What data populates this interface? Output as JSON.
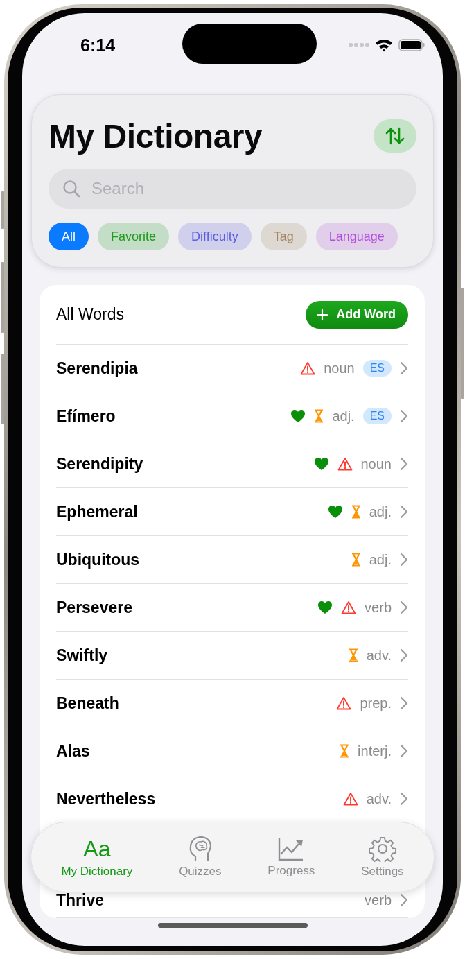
{
  "status_bar": {
    "time": "6:14"
  },
  "header": {
    "title": "My Dictionary",
    "search": {
      "placeholder": "Search"
    },
    "filters": [
      {
        "label": "All",
        "selected": true,
        "color": "#0a7aff"
      },
      {
        "label": "Favorite",
        "selected": false,
        "color": "#1e9a1e"
      },
      {
        "label": "Difficulty",
        "selected": false,
        "color": "#5b5ce0"
      },
      {
        "label": "Tag",
        "selected": false,
        "color": "#a2845e"
      },
      {
        "label": "Language",
        "selected": false,
        "color": "#b04fd8"
      }
    ]
  },
  "list": {
    "title": "All Words",
    "add_button": "Add Word",
    "rows": [
      {
        "word": "Serendipia",
        "favorite": false,
        "warning": true,
        "pending": false,
        "pos": "noun",
        "language": "ES"
      },
      {
        "word": "Efímero",
        "favorite": true,
        "warning": false,
        "pending": true,
        "pos": "adj.",
        "language": "ES"
      },
      {
        "word": "Serendipity",
        "favorite": true,
        "warning": true,
        "pending": false,
        "pos": "noun"
      },
      {
        "word": "Ephemeral",
        "favorite": true,
        "warning": false,
        "pending": true,
        "pos": "adj."
      },
      {
        "word": "Ubiquitous",
        "favorite": false,
        "warning": false,
        "pending": true,
        "pos": "adj."
      },
      {
        "word": "Persevere",
        "favorite": true,
        "warning": true,
        "pending": false,
        "pos": "verb"
      },
      {
        "word": "Swiftly",
        "favorite": false,
        "warning": false,
        "pending": true,
        "pos": "adv."
      },
      {
        "word": "Beneath",
        "favorite": false,
        "warning": true,
        "pending": false,
        "pos": "prep."
      },
      {
        "word": "Alas",
        "favorite": false,
        "warning": false,
        "pending": true,
        "pos": "interj."
      },
      {
        "word": "Nevertheless",
        "favorite": false,
        "warning": true,
        "pending": false,
        "pos": "adv."
      },
      {
        "word": "Thrive",
        "favorite": false,
        "warning": false,
        "pending": false,
        "pos": "verb"
      }
    ]
  },
  "tab_bar": [
    {
      "label": "My Dictionary",
      "selected": true,
      "glyph": "Aa"
    },
    {
      "label": "Quizzes",
      "selected": false
    },
    {
      "label": "Progress",
      "selected": false
    },
    {
      "label": "Settings",
      "selected": false
    }
  ]
}
